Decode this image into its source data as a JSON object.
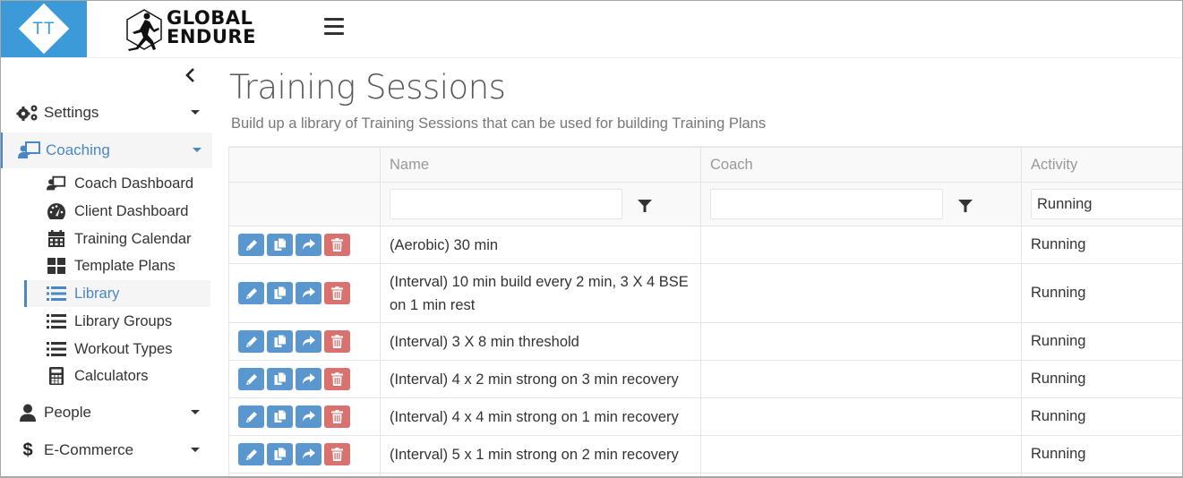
{
  "header": {
    "brand_initials": "TT",
    "logo_line1": "GLOBAL",
    "logo_line2": "ENDURE",
    "menu_icon": "hamburger-icon"
  },
  "sidebar": {
    "collapse_icon": "chevron-left-icon",
    "items": [
      {
        "label": "Settings",
        "icon": "cogs-icon",
        "expanded": false
      },
      {
        "label": "Coaching",
        "icon": "chalkboard-teacher-icon",
        "expanded": true,
        "active": true,
        "children": [
          {
            "label": "Coach Dashboard",
            "icon": "chalkboard-teacher-icon"
          },
          {
            "label": "Client Dashboard",
            "icon": "tachometer-icon"
          },
          {
            "label": "Training Calendar",
            "icon": "calendar-icon"
          },
          {
            "label": "Template Plans",
            "icon": "th-large-icon"
          },
          {
            "label": "Library",
            "icon": "list-icon",
            "active": true
          },
          {
            "label": "Library Groups",
            "icon": "list-icon"
          },
          {
            "label": "Workout Types",
            "icon": "list-icon"
          },
          {
            "label": "Calculators",
            "icon": "calculator-icon"
          }
        ]
      },
      {
        "label": "People",
        "icon": "user-icon",
        "expanded": false
      },
      {
        "label": "E-Commerce",
        "icon": "dollar-icon",
        "expanded": false
      }
    ]
  },
  "main": {
    "title": "Training Sessions",
    "subtitle": "Build up a library of Training Sessions that can be used for building Training Plans",
    "table": {
      "columns": [
        "",
        "Name",
        "Coach",
        "Activity"
      ],
      "filters": {
        "name": {
          "value": "",
          "placeholder": ""
        },
        "coach": {
          "value": "",
          "placeholder": ""
        },
        "activity": {
          "value": "Running"
        }
      },
      "row_actions": [
        "edit",
        "copy",
        "share",
        "delete"
      ],
      "rows": [
        {
          "name": "(Aerobic) 30 min",
          "coach": "",
          "activity": "Running"
        },
        {
          "name": "(Interval) 10 min build every 2 min, 3 X 4 BSE on 1 min rest",
          "coach": "",
          "activity": "Running"
        },
        {
          "name": "(Interval) 3 X 8 min threshold",
          "coach": "",
          "activity": "Running"
        },
        {
          "name": "(Interval) 4 x 2 min strong on 3 min recovery",
          "coach": "",
          "activity": "Running"
        },
        {
          "name": "(Interval) 4 x 4 min strong on 1 min recovery",
          "coach": "",
          "activity": "Running"
        },
        {
          "name": "(Interval) 5 x 1 min strong on 2 min recovery",
          "coach": "",
          "activity": "Running"
        }
      ]
    }
  },
  "colors": {
    "brand": "#3d9ad9",
    "active": "#4a87c7",
    "button_blue": "#5b97cf",
    "button_red": "#d9726f"
  }
}
